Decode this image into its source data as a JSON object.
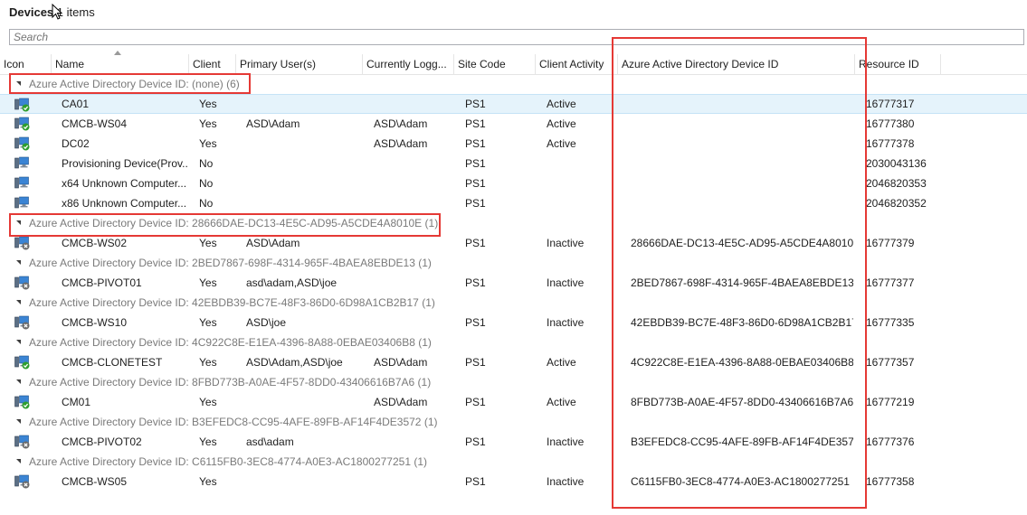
{
  "title": {
    "label": "Devices",
    "count": "1",
    "suffix": "items"
  },
  "search": {
    "placeholder": "Search"
  },
  "columns": [
    "Icon",
    "Name",
    "Client",
    "Primary User(s)",
    "Currently Logg...",
    "Site Code",
    "Client Activity",
    "Azure Active Directory Device ID",
    "Resource ID"
  ],
  "groups": [
    {
      "label": "Azure Active Directory Device ID: (none) (6)",
      "rows": [
        {
          "icon": "computer-active-icon",
          "name": "CA01",
          "client": "Yes",
          "primary_user": "",
          "logged_on": "",
          "site": "PS1",
          "activity": "Active",
          "aad_id": "",
          "resource_id": "16777317",
          "selected": true
        },
        {
          "icon": "computer-active-icon",
          "name": "CMCB-WS04",
          "client": "Yes",
          "primary_user": "ASD\\Adam",
          "logged_on": "ASD\\Adam",
          "site": "PS1",
          "activity": "Active",
          "aad_id": "",
          "resource_id": "16777380"
        },
        {
          "icon": "computer-active-icon",
          "name": "DC02",
          "client": "Yes",
          "primary_user": "",
          "logged_on": "ASD\\Adam",
          "site": "PS1",
          "activity": "Active",
          "aad_id": "",
          "resource_id": "16777378"
        },
        {
          "icon": "computer-unknown-icon",
          "name": "Provisioning Device(Prov...",
          "client": "No",
          "primary_user": "",
          "logged_on": "",
          "site": "PS1",
          "activity": "",
          "aad_id": "",
          "resource_id": "2030043136"
        },
        {
          "icon": "computer-unknown-icon",
          "name": "x64 Unknown Computer...",
          "client": "No",
          "primary_user": "",
          "logged_on": "",
          "site": "PS1",
          "activity": "",
          "aad_id": "",
          "resource_id": "2046820353"
        },
        {
          "icon": "computer-unknown-icon",
          "name": "x86 Unknown Computer...",
          "client": "No",
          "primary_user": "",
          "logged_on": "",
          "site": "PS1",
          "activity": "",
          "aad_id": "",
          "resource_id": "2046820352"
        }
      ]
    },
    {
      "label": "Azure Active Directory Device ID: 28666DAE-DC13-4E5C-AD95-A5CDE4A8010E (1)",
      "rows": [
        {
          "icon": "computer-inactive-icon",
          "name": "CMCB-WS02",
          "client": "Yes",
          "primary_user": "ASD\\Adam",
          "logged_on": "",
          "site": "PS1",
          "activity": "Inactive",
          "aad_id": "28666DAE-DC13-4E5C-AD95-A5CDE4A8010E",
          "resource_id": "16777379"
        }
      ]
    },
    {
      "label": "Azure Active Directory Device ID: 2BED7867-698F-4314-965F-4BAEA8EBDE13 (1)",
      "rows": [
        {
          "icon": "computer-inactive-icon",
          "name": "CMCB-PIVOT01",
          "client": "Yes",
          "primary_user": "asd\\adam,ASD\\joe",
          "logged_on": "",
          "site": "PS1",
          "activity": "Inactive",
          "aad_id": "2BED7867-698F-4314-965F-4BAEA8EBDE13",
          "resource_id": "16777377"
        }
      ]
    },
    {
      "label": "Azure Active Directory Device ID: 42EBDB39-BC7E-48F3-86D0-6D98A1CB2B17 (1)",
      "rows": [
        {
          "icon": "computer-inactive-icon",
          "name": "CMCB-WS10",
          "client": "Yes",
          "primary_user": "ASD\\joe",
          "logged_on": "",
          "site": "PS1",
          "activity": "Inactive",
          "aad_id": "42EBDB39-BC7E-48F3-86D0-6D98A1CB2B17",
          "resource_id": "16777335"
        }
      ]
    },
    {
      "label": "Azure Active Directory Device ID: 4C922C8E-E1EA-4396-8A88-0EBAE03406B8 (1)",
      "rows": [
        {
          "icon": "computer-active-icon",
          "name": "CMCB-CLONETEST",
          "client": "Yes",
          "primary_user": "ASD\\Adam,ASD\\joe",
          "logged_on": "ASD\\Adam",
          "site": "PS1",
          "activity": "Active",
          "aad_id": "4C922C8E-E1EA-4396-8A88-0EBAE03406B8",
          "resource_id": "16777357"
        }
      ]
    },
    {
      "label": "Azure Active Directory Device ID: 8FBD773B-A0AE-4F57-8DD0-43406616B7A6 (1)",
      "rows": [
        {
          "icon": "computer-active-icon",
          "name": "CM01",
          "client": "Yes",
          "primary_user": "",
          "logged_on": "ASD\\Adam",
          "site": "PS1",
          "activity": "Active",
          "aad_id": "8FBD773B-A0AE-4F57-8DD0-43406616B7A6",
          "resource_id": "16777219"
        }
      ]
    },
    {
      "label": "Azure Active Directory Device ID: B3EFEDC8-CC95-4AFE-89FB-AF14F4DE3572 (1)",
      "rows": [
        {
          "icon": "computer-inactive-icon",
          "name": "CMCB-PIVOT02",
          "client": "Yes",
          "primary_user": "asd\\adam",
          "logged_on": "",
          "site": "PS1",
          "activity": "Inactive",
          "aad_id": "B3EFEDC8-CC95-4AFE-89FB-AF14F4DE3572",
          "resource_id": "16777376"
        }
      ]
    },
    {
      "label": "Azure Active Directory Device ID: C6115FB0-3EC8-4774-A0E3-AC1800277251 (1)",
      "rows": [
        {
          "icon": "computer-inactive-icon",
          "name": "CMCB-WS05",
          "client": "Yes",
          "primary_user": "",
          "logged_on": "",
          "site": "PS1",
          "activity": "Inactive",
          "aad_id": "C6115FB0-3EC8-4774-A0E3-AC1800277251",
          "resource_id": "16777358"
        }
      ]
    }
  ],
  "colors": {
    "highlight": "#e53935",
    "selected_row": "#e5f3fb",
    "active_badge": "#2e9e2e",
    "inactive_badge": "#6b6b6b"
  }
}
